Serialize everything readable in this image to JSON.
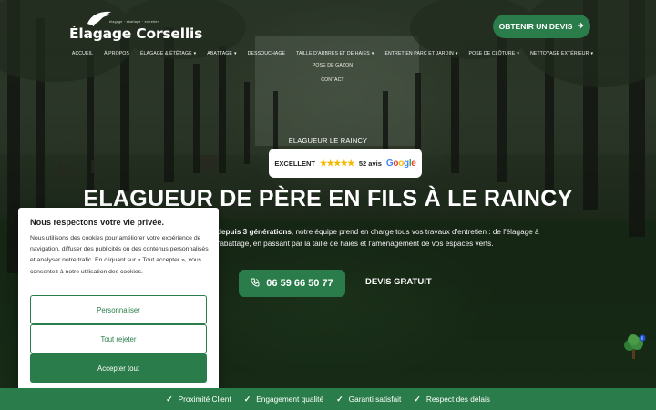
{
  "header": {
    "logo_text": "Élagage Corsellis",
    "logo_tagline": "élagage · abattage · entretien",
    "cta_label": "OBTENIR UN DEVIS",
    "cta_icon": "arrow-right-icon"
  },
  "nav": {
    "items": [
      {
        "label": "ACCUEIL",
        "dropdown": false
      },
      {
        "label": "À PROPOS",
        "dropdown": false
      },
      {
        "label": "ÉLAGAGE & ÉTÊTAGE",
        "dropdown": true
      },
      {
        "label": "ABATTAGE",
        "dropdown": true
      },
      {
        "label": "DESSOUCHAGE",
        "dropdown": false
      },
      {
        "label": "TAILLE D'ARBRES ET DE HAIES",
        "dropdown": true
      },
      {
        "label": "ENTRETIEN PARC ET JARDIN",
        "dropdown": true
      },
      {
        "label": "POSE DE CLÔTURE",
        "dropdown": true
      },
      {
        "label": "NETTOYAGE EXTÉRIEUR",
        "dropdown": true
      },
      {
        "label": "POSE DE GAZON",
        "dropdown": false
      }
    ],
    "second_row": [
      {
        "label": "CONTACT",
        "dropdown": false
      }
    ]
  },
  "hero": {
    "kicker": "ELAGUEUR LE RAINCY",
    "review": {
      "rating_label": "EXCELLENT",
      "stars": "★★★★★",
      "count": "52 avis",
      "brand": "Google",
      "brand_colors": [
        "#4285F4",
        "#EA4335",
        "#FBBC05",
        "#4285F4",
        "#34A853",
        "#EA4335"
      ]
    },
    "title": "ELAGUEUR DE PÈRE EN FILS À LE RAINCY",
    "desc_bold": "depuis 3 générations",
    "desc_line1": ", notre équipe prend en charge tous vos travaux d'entretien : de l'élagage à",
    "desc_line2": "l'abattage, en passant par la taille de haies et l'aménagement de vos espaces verts.",
    "phone_label": "06 59 66 50 77",
    "phone_icon": "phone-icon",
    "devis_label": "DEVIS GRATUIT"
  },
  "cookie": {
    "title": "Nous respectons votre vie privée.",
    "text": "Nous utilisons des cookies pour améliorer votre expérience de navigation, diffuser des publicités ou des contenus personnalisés et analyser notre trafic. En cliquant sur « Tout accepter », vous consentez à notre utilisation des cookies.",
    "customize_label": "Personnaliser",
    "reject_label": "Tout rejeter",
    "accept_label": "Accepter tout"
  },
  "ribbon": {
    "items": [
      "Proximité Client",
      "Engagement qualité",
      "Garanti satisfait",
      "Respect des délais"
    ]
  },
  "colors": {
    "brand_green": "#2a7d4a",
    "star_yellow": "#f5b800"
  }
}
